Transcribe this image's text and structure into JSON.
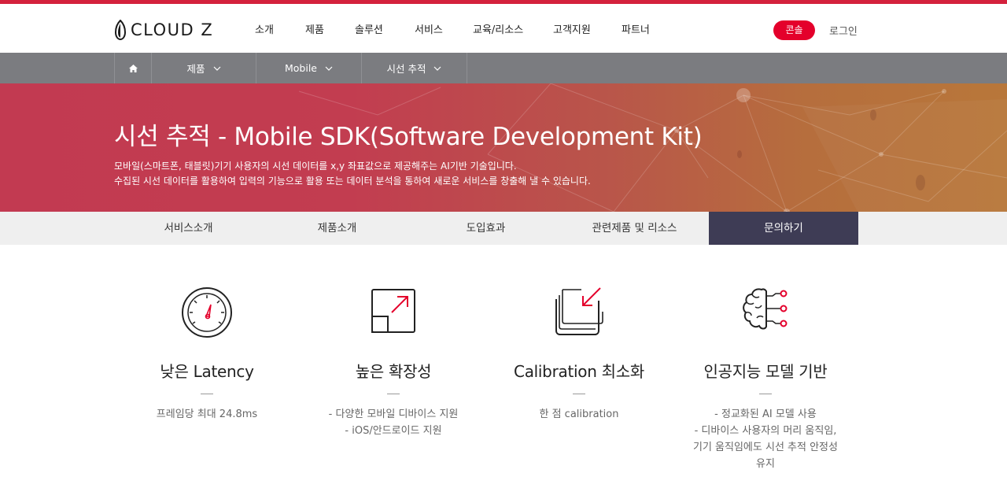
{
  "brand": {
    "name": "CLOUD Z",
    "accent": "#e4002b",
    "tab_active_bg": "#3e3c55"
  },
  "header": {
    "nav": [
      "소개",
      "제품",
      "솔루션",
      "서비스",
      "교육/리소스",
      "고객지원",
      "파트너"
    ],
    "console_label": "콘솔",
    "login_label": "로그인"
  },
  "breadcrumb": {
    "home_icon": "home-icon",
    "items": [
      "제품",
      "Mobile",
      "시선 추적"
    ]
  },
  "hero": {
    "title": "시선 추적 - Mobile SDK(Software Development Kit)",
    "desc_line1": "모바일(스마트폰, 태블릿)기기 사용자의 시선 데이터를 x,y 좌표값으로 제공해주는 AI기반 기술입니다.",
    "desc_line2": "수집된 시선 데이터를 활용하여 입력의 기능으로 활용 또는 데이터 분석을 통하여 새로운 서비스를 창출해 낼 수 있습니다."
  },
  "tabs": [
    {
      "label": "서비스소개"
    },
    {
      "label": "제품소개"
    },
    {
      "label": "도입효과"
    },
    {
      "label": "관련제품 및 리소스"
    },
    {
      "label": "문의하기"
    }
  ],
  "active_tab": "문의하기",
  "features": [
    {
      "icon": "speedometer-icon",
      "title": "낮은 Latency",
      "lines": [
        "프레임당 최대 24.8ms"
      ]
    },
    {
      "icon": "expand-arrow-icon",
      "title": "높은 확장성",
      "lines": [
        "- 다양한 모바일 디바이스 지원",
        "- iOS/안드로이드 지원"
      ]
    },
    {
      "icon": "calibration-icon",
      "title": "Calibration 최소화",
      "lines": [
        "한 점 calibration"
      ]
    },
    {
      "icon": "ai-brain-icon",
      "title": "인공지능 모델 기반",
      "lines": [
        "- 정교화된 AI 모델 사용",
        "- 디바이스 사용자의 머리 움직임,",
        "기기 움직임에도 시선 추적 안정성",
        "유지"
      ]
    }
  ]
}
